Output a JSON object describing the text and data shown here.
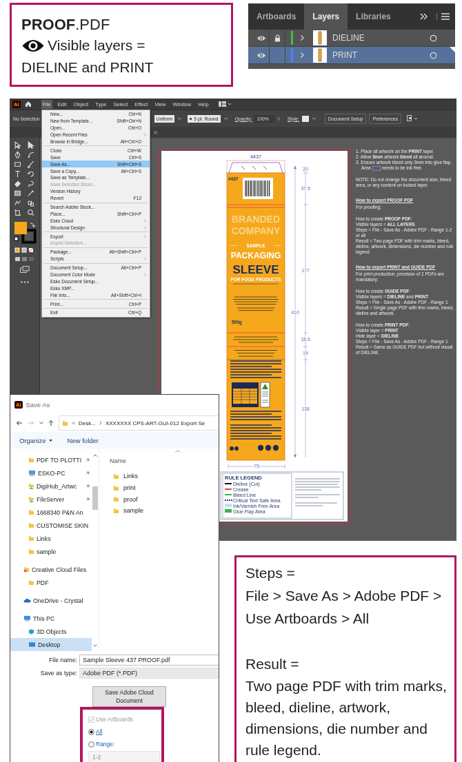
{
  "proof_note": {
    "title": "**PROOF**.PDF",
    "visible_label": "Visible layers =",
    "visible_value": "DIELINE and PRINT"
  },
  "layers_panel": {
    "tabs": [
      {
        "label": "Artboards",
        "selected": false
      },
      {
        "label": "Layers",
        "selected": true
      },
      {
        "label": "Libraries",
        "selected": false
      }
    ],
    "layers": [
      {
        "name": "DIELINE",
        "visible": true,
        "locked": true,
        "selected": false,
        "color": "#3fbf3f"
      },
      {
        "name": "PRINT",
        "visible": true,
        "locked": false,
        "selected": true,
        "color": "#4f7fff"
      }
    ]
  },
  "illustrator": {
    "logo": "Ai",
    "menu": [
      {
        "label": "File",
        "selected": true
      },
      {
        "label": "Edit",
        "selected": false
      },
      {
        "label": "Object",
        "selected": false
      },
      {
        "label": "Type",
        "selected": false
      },
      {
        "label": "Select",
        "selected": false
      },
      {
        "label": "Effect",
        "selected": false
      },
      {
        "label": "View",
        "selected": false
      },
      {
        "label": "Window",
        "selected": false
      },
      {
        "label": "Help",
        "selected": false
      }
    ],
    "control_bar": {
      "selection": "No Selection",
      "profile": "Uniform",
      "brush": "5 pt. Round",
      "opacity_label": "Opacity:",
      "opacity": "100%",
      "style_label": "Style:",
      "buttons": [
        "Document Setup",
        "Preferences"
      ]
    },
    "file_menu": [
      [
        {
          "label": "New...",
          "shortcut": "Ctrl+N",
          "selected": false,
          "disabled": false,
          "submenu": false
        },
        {
          "label": "New from Template...",
          "shortcut": "Shift+Ctrl+N",
          "selected": false,
          "disabled": false,
          "submenu": false
        },
        {
          "label": "Open...",
          "shortcut": "Ctrl+O",
          "selected": false,
          "disabled": false,
          "submenu": false
        },
        {
          "label": "Open Recent Files",
          "selected": false,
          "disabled": false,
          "submenu": true
        },
        {
          "label": "Browse in Bridge...",
          "shortcut": "Alt+Ctrl+O",
          "selected": false,
          "disabled": false,
          "submenu": false
        }
      ],
      [
        {
          "label": "Close",
          "shortcut": "Ctrl+W",
          "selected": false,
          "disabled": false,
          "submenu": false
        },
        {
          "label": "Save",
          "shortcut": "Ctrl+S",
          "selected": false,
          "disabled": false,
          "submenu": false
        },
        {
          "label": "Save As...",
          "shortcut": "Shift+Ctrl+S",
          "selected": true,
          "disabled": false,
          "submenu": false
        },
        {
          "label": "Save a Copy...",
          "shortcut": "Alt+Ctrl+S",
          "selected": false,
          "disabled": false,
          "submenu": false
        },
        {
          "label": "Save as Template...",
          "selected": false,
          "disabled": false,
          "submenu": false
        },
        {
          "label": "Save Selected Slices...",
          "selected": false,
          "disabled": true,
          "submenu": false
        },
        {
          "label": "Version History",
          "selected": false,
          "disabled": false,
          "submenu": false
        },
        {
          "label": "Revert",
          "shortcut": "F12",
          "selected": false,
          "disabled": false,
          "submenu": false
        }
      ],
      [
        {
          "label": "Search Adobe Stock...",
          "selected": false,
          "disabled": false,
          "submenu": false
        },
        {
          "label": "Place...",
          "shortcut": "Shift+Ctrl+P",
          "selected": false,
          "disabled": false,
          "submenu": false
        },
        {
          "label": "Esko Cloud",
          "selected": false,
          "disabled": false,
          "submenu": true
        },
        {
          "label": "Structural Design",
          "selected": false,
          "disabled": false,
          "submenu": true
        }
      ],
      [
        {
          "label": "Export",
          "selected": false,
          "disabled": false,
          "submenu": true
        },
        {
          "label": "Export Selection...",
          "selected": false,
          "disabled": true,
          "submenu": false
        }
      ],
      [
        {
          "label": "Package...",
          "shortcut": "Alt+Shift+Ctrl+P",
          "selected": false,
          "disabled": false,
          "submenu": false
        },
        {
          "label": "Scripts",
          "selected": false,
          "disabled": false,
          "submenu": true
        }
      ],
      [
        {
          "label": "Document Setup...",
          "shortcut": "Alt+Ctrl+P",
          "selected": false,
          "disabled": false,
          "submenu": false
        },
        {
          "label": "Document Color Mode",
          "selected": false,
          "disabled": false,
          "submenu": true
        },
        {
          "label": "Esko Document Setup...",
          "selected": false,
          "disabled": false,
          "submenu": false
        },
        {
          "label": "Esko XMP...",
          "selected": false,
          "disabled": false,
          "submenu": false
        },
        {
          "label": "File Info...",
          "shortcut": "Alt+Shift+Ctrl+I",
          "selected": false,
          "disabled": false,
          "submenu": false
        }
      ],
      [
        {
          "label": "Print...",
          "shortcut": "Ctrl+P",
          "selected": false,
          "disabled": false,
          "submenu": false
        }
      ],
      [
        {
          "label": "Exit",
          "shortcut": "Ctrl+Q",
          "selected": false,
          "disabled": false,
          "submenu": false
        }
      ]
    ],
    "artboard": {
      "die_number": "#437",
      "flap_number": "#437",
      "brand": [
        "BRANDED",
        "COMPANY"
      ],
      "tagline": "SAMPLE",
      "product": [
        "PACKAGING",
        "SLEEVE"
      ],
      "subtitle": "FOR FOOD PRODUCTS",
      "weight": "500g",
      "height_dimension": "410",
      "panel_dimensions": [
        "20",
        "37.5",
        "177",
        "18.5",
        "19",
        "138"
      ],
      "width_dimension": "75",
      "legend": {
        "title": "RULE LEGEND",
        "items": [
          {
            "label": "Dieline (Cut)",
            "kind": "line",
            "color": "#111111"
          },
          {
            "label": "Crease",
            "kind": "line",
            "color": "#e8413b"
          },
          {
            "label": "Bleed Line",
            "kind": "line",
            "color": "#3cb54a"
          },
          {
            "label": "Critical Text Safe Area",
            "kind": "dotted",
            "color": "#2b3a6e"
          },
          {
            "label": "Ink/Varnish Free Area",
            "kind": "fill",
            "color": "#bfe3f5"
          },
          {
            "label": "Glue Flap Area",
            "kind": "fill",
            "color": "#3cb54a"
          }
        ]
      }
    },
    "instructions": [
      {
        "kind": "para",
        "lines": [
          "1.  Place all artwork on the **PRINT** layer.",
          "2.  Allow **3mm** artwork **bleed** all around.",
          "3.  Ensure artwork bleed only 3mm into glue flap."
        ]
      },
      {
        "kind": "swatch",
        "before": "Area",
        "after": "needs to be ink free."
      },
      {
        "kind": "para",
        "lines": [
          "NOTE: Do not change the document size, bleed area, or any content on locked layer."
        ]
      },
      {
        "kind": "heading",
        "text": "How to export PROOF PDF"
      },
      {
        "kind": "para",
        "lines": [
          "For proofing:"
        ]
      },
      {
        "kind": "para",
        "lines": [
          "How to create **PROOF PDF**:",
          "Visible layers = **ALL LAYERS**",
          "Steps = File - Save As - Adobe PDF - Range 1-2 or all",
          "Result = Two-page PDF with trim marks, bleed, dieline, artwork, dimensions, die number and rule legend."
        ]
      },
      {
        "kind": "heading",
        "text": "How to export PRINT and GUIDE PDF"
      },
      {
        "kind": "para",
        "lines": [
          "For print production, provision of 2 PDFs are mandatory:"
        ]
      },
      {
        "kind": "para",
        "lines": [
          "How to create **GUIDE PDF**:",
          "Visible layers = **DIELINE** and **PRINT**",
          "Steps = File - Save As - Adobe PDF - Range 1",
          "Result = Single page PDF with trim marks, bleed, dieline and artwork."
        ]
      },
      {
        "kind": "para",
        "lines": [
          "How to create **PRINT PDF**:",
          "Visible layer = **PRINT**",
          "Hide layer = **DIELINE**",
          "Steps = File - Save As - Adobe PDF - Range 1",
          "Result = Same as GUIDE PDF but without visual of DIELINE."
        ]
      }
    ]
  },
  "save_dialog": {
    "logo": "Ai",
    "title": "Save As",
    "breadcrumb": [
      "Desk...",
      "XXXXXXX CPS-ART-GUI-012 Export Se"
    ],
    "toolbar": [
      {
        "label": "Organize",
        "dropdown": true
      },
      {
        "label": "New folder",
        "dropdown": false
      }
    ],
    "nav": [
      {
        "items": [
          {
            "name": "PDF TO PLOTTI",
            "kind": "folder",
            "pinned": true,
            "selected": false
          },
          {
            "name": "ESKO-PC",
            "kind": "computer",
            "pinned": true,
            "selected": false
          },
          {
            "name": "DigiHub_Artwc",
            "kind": "drive",
            "pinned": true,
            "selected": false
          },
          {
            "name": "FileServer",
            "kind": "drive",
            "pinned": true,
            "selected": false
          },
          {
            "name": "1668340 P&N An",
            "kind": "folder",
            "pinned": false,
            "selected": false
          },
          {
            "name": "CUSTOMISE SKIN",
            "kind": "folder",
            "pinned": false,
            "selected": false
          },
          {
            "name": "Links",
            "kind": "folder",
            "pinned": false,
            "selected": false
          },
          {
            "name": "sample",
            "kind": "folder",
            "pinned": false,
            "selected": false
          }
        ]
      },
      {
        "header": {
          "name": "Creative Cloud Files",
          "kind": "cc",
          "pinned": false,
          "selected": false
        },
        "items": [
          {
            "name": "PDF",
            "kind": "folder",
            "pinned": false,
            "selected": false
          }
        ]
      },
      {
        "header": {
          "name": "OneDrive - Crystal",
          "kind": "onedrive",
          "pinned": false,
          "selected": false
        }
      },
      {
        "header": {
          "name": "This PC",
          "kind": "pc",
          "pinned": false,
          "selected": false
        },
        "items": [
          {
            "name": "3D Objects",
            "kind": "cube",
            "pinned": false,
            "selected": false
          },
          {
            "name": "Desktop",
            "kind": "desktop",
            "pinned": false,
            "selected": true
          }
        ]
      }
    ],
    "column": "Name",
    "files": [
      {
        "name": "Links",
        "selected": false
      },
      {
        "name": "print",
        "selected": false
      },
      {
        "name": "proof",
        "selected": false
      },
      {
        "name": "sample",
        "selected": false
      }
    ],
    "file_name_label": "File name:",
    "file_name": "Sample Sleeve 437 PROOF.pdf",
    "type_label": "Save as type:",
    "type": "Adobe PDF (*.PDF)",
    "cloud_button": "Save Adobe Cloud Document",
    "use_artboards": {
      "label": "Use Artboards",
      "checked": true,
      "disabled": true
    },
    "range_options": [
      {
        "label": "All",
        "selected": true
      },
      {
        "label": "Range:",
        "selected": false
      }
    ],
    "range": "1-2"
  },
  "steps_note": {
    "steps_label": "Steps =",
    "steps": "File > Save As > Adobe PDF > Use Artboards > All",
    "result_label": "Result =",
    "result": "Two page PDF with trim marks, bleed, dieline, artwork, dimensions, die number and rule legend."
  }
}
